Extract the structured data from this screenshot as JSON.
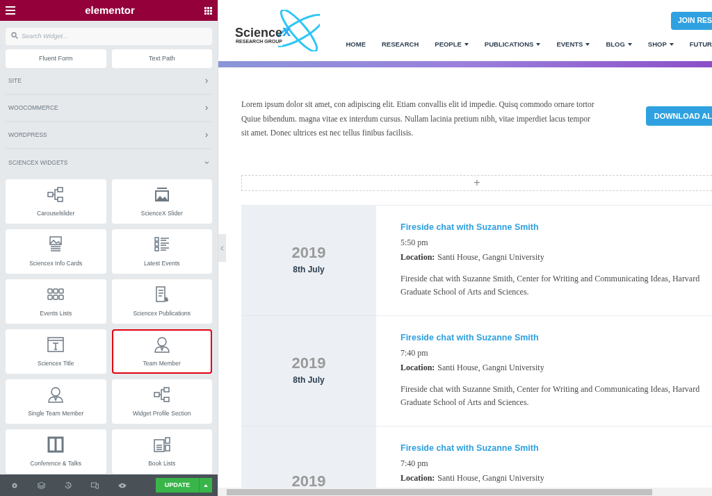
{
  "panel": {
    "title": "elementor",
    "search": {
      "placeholder": "Search Widget..."
    },
    "top_widgets": [
      "Fluent Form",
      "Text Path"
    ],
    "categories": [
      {
        "label": "SITE",
        "expanded": false
      },
      {
        "label": "WOOCOMMERCE",
        "expanded": false
      },
      {
        "label": "WORDPRESS",
        "expanded": false
      },
      {
        "label": "SCIENCEX WIDGETS",
        "expanded": true
      }
    ],
    "widgets": [
      {
        "label": "Carouselslider",
        "selected": false
      },
      {
        "label": "ScienceX Slider",
        "selected": false
      },
      {
        "label": "Sciencex Info Cards",
        "selected": false
      },
      {
        "label": "Latest Events",
        "selected": false
      },
      {
        "label": "Events Lists",
        "selected": false
      },
      {
        "label": "Sciencex Publications",
        "selected": false
      },
      {
        "label": "Sciencex Title",
        "selected": false
      },
      {
        "label": "Team Member",
        "selected": true
      },
      {
        "label": "Single Team Member",
        "selected": false
      },
      {
        "label": "Widget Profile Section",
        "selected": false
      },
      {
        "label": "Conference & Talks",
        "selected": false
      },
      {
        "label": "Book Lists",
        "selected": false
      }
    ],
    "footer": {
      "update_button": "UPDATE"
    }
  },
  "site": {
    "logo": {
      "name": "Science",
      "mark": "x",
      "tagline": "RESEARCH GROUP"
    },
    "join_button": "JOIN RES",
    "nav": [
      {
        "label": "HOME",
        "dropdown": false
      },
      {
        "label": "RESEARCH",
        "dropdown": false
      },
      {
        "label": "PEOPLE",
        "dropdown": true
      },
      {
        "label": "PUBLICATIONS",
        "dropdown": true
      },
      {
        "label": "EVENTS",
        "dropdown": true
      },
      {
        "label": "BLOG",
        "dropdown": true
      },
      {
        "label": "SHOP",
        "dropdown": true
      },
      {
        "label": "FUTUR",
        "dropdown": false
      }
    ],
    "intro": "Lorem ipsum dolor sit amet, con adipiscing elit. Etiam convallis elit id impedie. Quisq commodo ornare tortor Quiue bibendum. magna vitae ex interdum cursus. Nullam lacinia pretium nibh, vitae imperdiet lacus tempor sit amet. Donec ultrices est nec tellus finibus facilisis.",
    "download_button": "DOWNLOAD AL",
    "add_section": "+",
    "events": [
      {
        "year": "2019",
        "date": "8th July",
        "title": "Fireside chat with Suzanne Smith",
        "time": "5:50 pm",
        "location_label": "Location:",
        "location": "Santi House, Gangni University",
        "description": "Fireside chat with Suzanne Smith, Center for Writing and Communicating Ideas, Harvard Graduate School of Arts and Sciences."
      },
      {
        "year": "2019",
        "date": "8th July",
        "title": "Fireside chat with Suzanne Smith",
        "time": "7:40 pm",
        "location_label": "Location:",
        "location": "Santi House, Gangni University",
        "description": "Fireside chat with Suzanne Smith, Center for Writing and Communicating Ideas, Harvard Graduate School of Arts and Sciences."
      },
      {
        "year": "2019",
        "title": "Fireside chat with Suzanne Smith",
        "time": "7:40 pm",
        "location_label": "Location:",
        "location": "Santi House, Gangni University"
      }
    ]
  }
}
